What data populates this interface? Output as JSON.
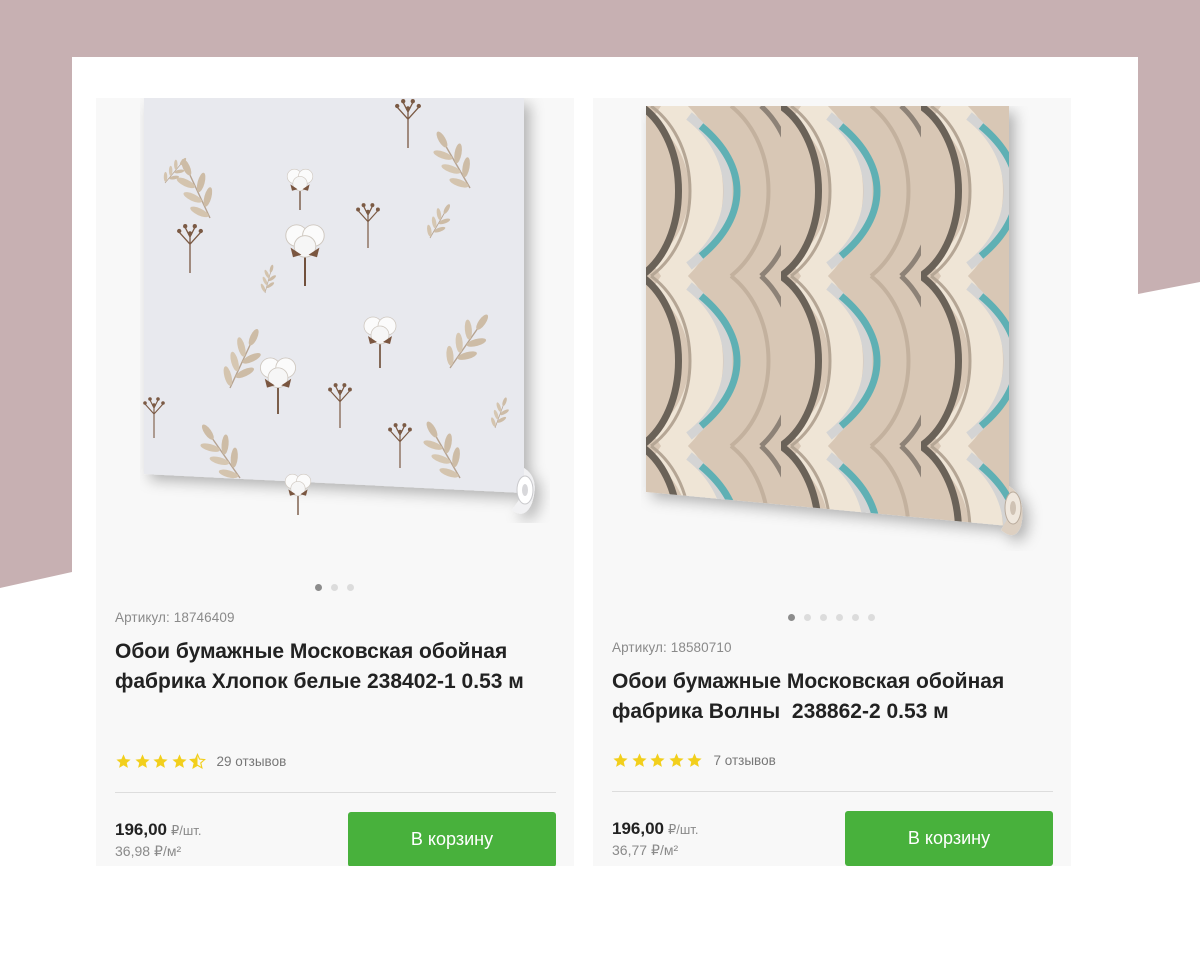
{
  "products": [
    {
      "sku": "Артикул: 18746409",
      "title": "Обои бумажные Московская обойная фабрика Хлопок белые 238402-1 0.53 м",
      "rating": 4.5,
      "reviews": "29 отзывов",
      "price": "196,00",
      "price_unit": "₽/шт.",
      "price_per_m2": "36,98",
      "price_per_m2_unit": "₽/м²",
      "button_label": "В корзину",
      "images_count": 3,
      "active_image": 1
    },
    {
      "sku": "Артикул: 18580710",
      "title": "Обои бумажные Московская обойная фабрика Волны  238862-2 0.53 м",
      "rating": 5,
      "reviews": "7 отзывов",
      "price": "196,00",
      "price_unit": "₽/шт.",
      "price_per_m2": "36,77",
      "price_per_m2_unit": "₽/м²",
      "button_label": "В корзину",
      "images_count": 6,
      "active_image": 1
    }
  ],
  "colors": {
    "background_shape": "#c7b0b2",
    "card_background": "#f8f8f8",
    "button": "#48b13c",
    "star": "#f2cf1c"
  },
  "icons": {
    "rating": "star-icon"
  }
}
